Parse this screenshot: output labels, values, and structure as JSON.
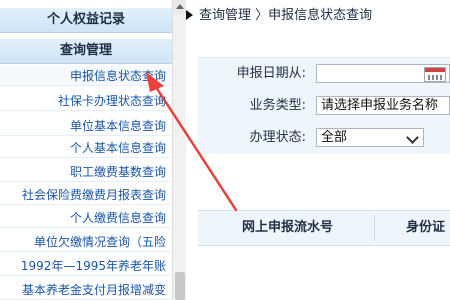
{
  "sidebar": {
    "groups": [
      {
        "label": "个人权益记录"
      },
      {
        "label": "查询管理"
      }
    ],
    "items": [
      {
        "label": "申报信息状态查询"
      },
      {
        "label": "社保卡办理状态查询"
      },
      {
        "label": "单位基本信息查询"
      },
      {
        "label": "个人基本信息查询"
      },
      {
        "label": "职工缴费基数查询"
      },
      {
        "label": "社会保险费缴费月报表查询"
      },
      {
        "label": "个人缴费信息查询"
      },
      {
        "label": "单位欠缴情况查询（五险"
      },
      {
        "label": "1992年—1995年养老年账"
      },
      {
        "label": "基本养老金支付月报增减变"
      }
    ]
  },
  "breadcrumb": {
    "text": "查询管理 〉申报信息状态查询"
  },
  "form": {
    "date_label": "申报日期从:",
    "date_value": "",
    "business_type_label": "业务类型:",
    "business_type_value": "请选择申报业务名称",
    "status_label": "办理状态:",
    "status_value": "全部"
  },
  "table": {
    "columns": [
      "网上申报流水号",
      "身份证"
    ]
  },
  "colors": {
    "accent_link": "#1a56a8",
    "annotation_arrow": "#e8403a"
  },
  "icons": [
    "calendar-icon",
    "chevron-down-icon",
    "scroll-up-icon",
    "breadcrumb-arrow-icon"
  ]
}
